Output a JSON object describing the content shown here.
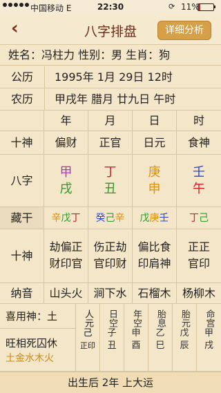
{
  "status": {
    "carrier": "中国移动  E",
    "time": "22:30",
    "battery": "11%"
  },
  "nav": {
    "title": "八字排盘",
    "detail_button": "详细分析"
  },
  "info": {
    "text": "姓名：冯柱力  性别：男  生肖：狗"
  },
  "solar": {
    "label": "公历",
    "value": "1995年 1月 29日 12时"
  },
  "lunar": {
    "label": "农历",
    "value": "甲戌年 腊月 廿九日 午时"
  },
  "columns": [
    "年",
    "月",
    "日",
    "时"
  ],
  "shishen1": {
    "label": "十神",
    "values": [
      "偏财",
      "正官",
      "日元",
      "食神"
    ]
  },
  "bazi": {
    "label": "八字",
    "gan": [
      "甲",
      "丁",
      "庚",
      "壬"
    ],
    "zhi": [
      "戌",
      "丑",
      "申",
      "午"
    ]
  },
  "canggan": {
    "label": "藏干",
    "values": [
      [
        "辛",
        "戊",
        "丁"
      ],
      [
        "癸",
        "己",
        "辛"
      ],
      [
        "戊",
        "庚",
        "壬"
      ],
      [
        "丁",
        "己"
      ]
    ]
  },
  "shishen2": {
    "label": "十神",
    "values": [
      [
        "劫偏正",
        "财印官"
      ],
      [
        "伤正劫",
        "官印财"
      ],
      [
        "偏比食",
        "印肩神"
      ],
      [
        "正正",
        "官印"
      ]
    ]
  },
  "nayin": {
    "label": "纳音",
    "values": [
      "山头火",
      "涧下水",
      "石榴木",
      "杨柳木"
    ]
  },
  "xiyong": {
    "label": "喜用神：土"
  },
  "wangxiang": {
    "label": "旺相死囚休",
    "values": "土金水木火"
  },
  "extra": [
    {
      "label": "人元",
      "value": [
        "己",
        "正印"
      ]
    },
    {
      "label": "日空",
      "value": [
        "子",
        "丑"
      ]
    },
    {
      "label": "年空",
      "value": [
        "申",
        "酉"
      ]
    },
    {
      "label": "胎息",
      "value": [
        "乙",
        "巳"
      ]
    },
    {
      "label": "胎元",
      "value": [
        "戊",
        "辰"
      ]
    },
    {
      "label": "命宫",
      "value": [
        "甲",
        "戌"
      ]
    }
  ],
  "footer": {
    "text": "出生后 2年 上大运"
  }
}
